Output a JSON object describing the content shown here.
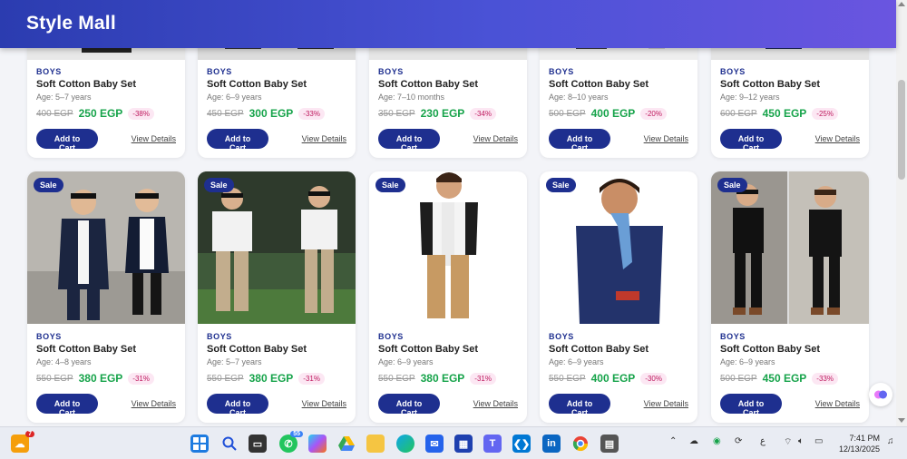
{
  "app": {
    "brand": "Style Mall"
  },
  "sale_label": "Sale",
  "add_to_cart_label": "Add to Cart",
  "view_details_label": "View Details",
  "row1": [
    {
      "category": "BOYS",
      "name": "Soft Cotton Baby Set",
      "age": "Age: 5–7 years",
      "old_price": "400 EGP",
      "new_price": "250 EGP",
      "discount": "-38%"
    },
    {
      "category": "BOYS",
      "name": "Soft Cotton Baby Set",
      "age": "Age: 6–9 years",
      "old_price": "450 EGP",
      "new_price": "300 EGP",
      "discount": "-33%"
    },
    {
      "category": "BOYS",
      "name": "Soft Cotton Baby Set",
      "age": "Age: 7–10 months",
      "old_price": "350 EGP",
      "new_price": "230 EGP",
      "discount": "-34%"
    },
    {
      "category": "BOYS",
      "name": "Soft Cotton Baby Set",
      "age": "Age: 8–10 years",
      "old_price": "500 EGP",
      "new_price": "400 EGP",
      "discount": "-20%"
    },
    {
      "category": "BOYS",
      "name": "Soft Cotton Baby Set",
      "age": "Age: 9–12 years",
      "old_price": "600 EGP",
      "new_price": "450 EGP",
      "discount": "-25%"
    }
  ],
  "row2": [
    {
      "category": "BOYS",
      "name": "Soft Cotton Baby Set",
      "age": "Age: 4–8 years",
      "old_price": "550 EGP",
      "new_price": "380 EGP",
      "discount": "-31%"
    },
    {
      "category": "BOYS",
      "name": "Soft Cotton Baby Set",
      "age": "Age: 5–7 years",
      "old_price": "550 EGP",
      "new_price": "380 EGP",
      "discount": "-31%"
    },
    {
      "category": "BOYS",
      "name": "Soft Cotton Baby Set",
      "age": "Age: 6–9 years",
      "old_price": "550 EGP",
      "new_price": "380 EGP",
      "discount": "-31%"
    },
    {
      "category": "BOYS",
      "name": "Soft Cotton Baby Set",
      "age": "Age: 6–9 years",
      "old_price": "550 EGP",
      "new_price": "400 EGP",
      "discount": "-30%"
    },
    {
      "category": "BOYS",
      "name": "Soft Cotton Baby Set",
      "age": "Age: 6–9 years",
      "old_price": "500 EGP",
      "new_price": "450 EGP",
      "discount": "-33%"
    }
  ],
  "taskbar": {
    "weather_badge": "7",
    "whatsapp_badge": "55",
    "language": "ع",
    "time": "7:41 PM",
    "date": "12/13/2025"
  },
  "icons": {
    "weather": "weather-icon",
    "start": "windows-start-icon",
    "search": "search-icon",
    "task_view": "task-view-icon",
    "whatsapp": "whatsapp-icon",
    "copilot": "copilot-icon",
    "drive": "google-drive-icon",
    "explorer": "file-explorer-icon",
    "edge": "edge-icon",
    "store": "store-icon",
    "teams": "teams-icon",
    "vscode": "vscode-icon",
    "linkedin": "linkedin-icon",
    "chrome": "chrome-icon",
    "calculator": "calculator-icon"
  },
  "colors": {
    "header_start": "#2b3cb0",
    "header_end": "#6a55e0",
    "primary": "#1e2f8f",
    "price_green": "#16a34a",
    "discount_pink": "#be185d"
  }
}
